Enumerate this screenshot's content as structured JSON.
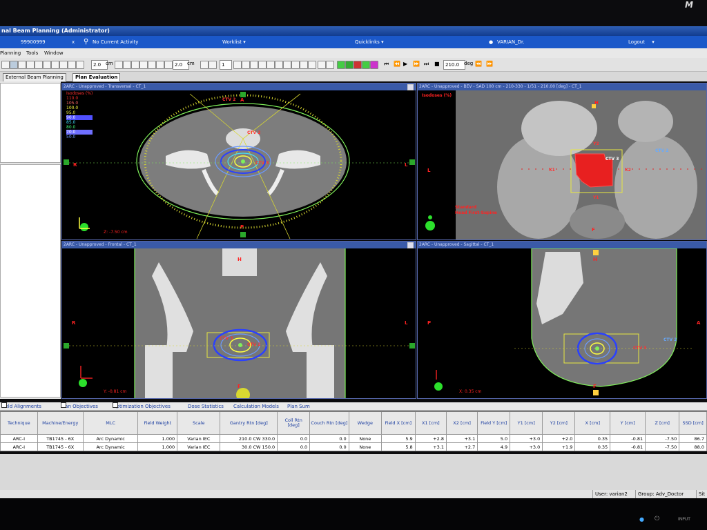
{
  "app": {
    "title": "nal Beam Planning (Administrator)",
    "brand": "M"
  },
  "activity_bar": {
    "patient_id": "99900999",
    "close": "x",
    "activity": "No Current Activity",
    "worklist": "Worklist",
    "quicklinks": "Quicklinks",
    "user": "VARIAN_Dr.",
    "logout": "Logout"
  },
  "menu": [
    "Planning",
    "Tools",
    "Window"
  ],
  "toolbar": {
    "zoom1": "2.0",
    "unit_cm1": "cm",
    "zoom2": "2.0",
    "unit_cm2": "cm",
    "zoom3": "1",
    "angle": "210.0",
    "unit_deg": "deg"
  },
  "tabs": {
    "tab1": "External Beam Planning",
    "tab2": "Plan Evaluation"
  },
  "isodose": {
    "title": "Isodoses (%)",
    "levels": [
      {
        "v": "110.0",
        "color": "#ff3030"
      },
      {
        "v": "105.0",
        "color": "#ff6a6a"
      },
      {
        "v": "100.0",
        "color": "#ffff40"
      },
      {
        "v": "95.0",
        "color": "#e8e840"
      },
      {
        "v": "90.0",
        "color": "#7070ff"
      },
      {
        "v": "85.0",
        "color": "#40e0ff"
      },
      {
        "v": "80.0",
        "color": "#40ff80"
      },
      {
        "v": "70.0",
        "color": "#a0a0ff"
      },
      {
        "v": "50.0",
        "color": "#6a9aff"
      }
    ]
  },
  "viewports": {
    "transversal": {
      "header": "2ARC - Unapproved - Transversal - CT_1",
      "ctv_a": "CTV 2",
      "ctv_b": "CTV 3",
      "left": "L",
      "right": "R",
      "anterior": "A",
      "posterior": "P",
      "coord": "Z: -7.50 cm"
    },
    "bev": {
      "header": "2ARC - Unapproved - BEV - SAD 100 cm - 210-330 - 1/51 - 210.00 [deg] - CT_1",
      "isodose": "Isodoses (%)",
      "ctv_a": "CTV 2",
      "ctv_b": "CTV 3",
      "y1": "Y1",
      "y2": "Y2",
      "x1": "X1",
      "x2": "X2",
      "left": "L",
      "foot": "F",
      "head": "H",
      "orient1": "Standard",
      "orient2": "Head First-Supine"
    },
    "frontal": {
      "header": "2ARC - Unapproved - Frontal - CT_1",
      "ctv_a": "CTV 2",
      "ctv_b": "CTV 3",
      "left": "L",
      "right": "R",
      "head": "H",
      "foot": "F",
      "coord": "Y: -0.81 cm"
    },
    "sagittal": {
      "header": "2ARC - Unapproved - Sagittal - CT_1",
      "ctv_a": "CTV 2",
      "ctv_b": "CTV 3",
      "posterior": "P",
      "anterior": "A",
      "head": "H",
      "foot": "F",
      "coord": "X: 0.35 cm"
    }
  },
  "bottom_tabs": [
    "Field Alignments",
    "Plan Objectives",
    "Optimization Objectives",
    "Dose Statistics",
    "Calculation Models",
    "Plan Sum"
  ],
  "fields_table": {
    "headers": [
      "Technique",
      "Machine/Energy",
      "MLC",
      "Field Weight",
      "Scale",
      "Gantry Rtn [deg]",
      "Coll Rtn [deg]",
      "Couch Rtn [deg]",
      "Wedge",
      "Field X [cm]",
      "X1 [cm]",
      "X2 [cm]",
      "Field Y [cm]",
      "Y1 [cm]",
      "Y2 [cm]",
      "X [cm]",
      "Y [cm]",
      "Z [cm]",
      "SSD [cm]"
    ],
    "rows": [
      [
        "ARC-I",
        "TB1745 - 6X",
        "Arc Dynamic",
        "1.000",
        "Varian IEC",
        "210.0 CW 330.0",
        "0.0",
        "0.0",
        "None",
        "5.9",
        "+2.8",
        "+3.1",
        "5.0",
        "+3.0",
        "+2.0",
        "0.35",
        "-0.81",
        "-7.50",
        "86.7"
      ],
      [
        "ARC-I",
        "TB1745 - 6X",
        "Arc Dynamic",
        "1.000",
        "Varian IEC",
        "30.0 CW 150.0",
        "0.0",
        "0.0",
        "None",
        "5.8",
        "+3.1",
        "+2.7",
        "4.9",
        "+3.0",
        "+1.9",
        "0.35",
        "-0.81",
        "-7.50",
        "88.0"
      ]
    ]
  },
  "status": {
    "user": "User: varian2",
    "group": "Group: Adv_Doctor",
    "site": "Sit"
  },
  "bezel": {
    "input": "INPUT"
  }
}
